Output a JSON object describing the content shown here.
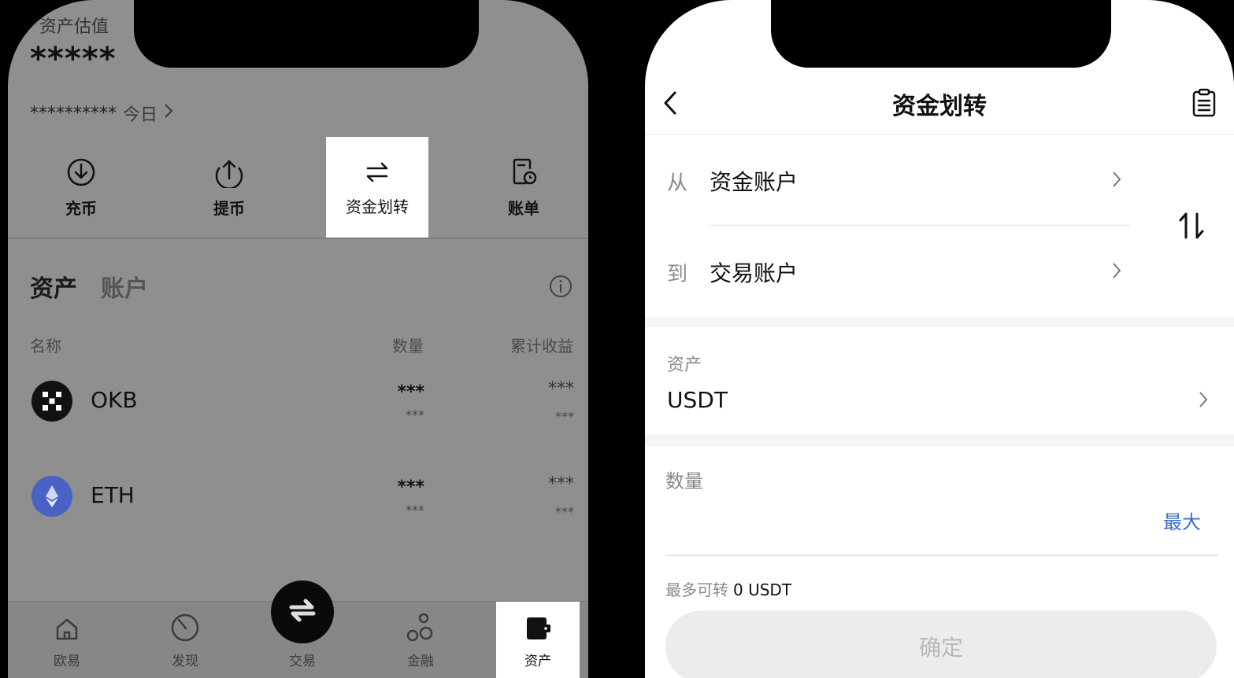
{
  "left": {
    "partial_title": "资产估值",
    "balance_masked": "*****",
    "sub_masked": "**********",
    "sub_today": "今日",
    "actions": [
      {
        "label": "充币",
        "icon": "deposit-icon"
      },
      {
        "label": "提币",
        "icon": "withdraw-icon"
      },
      {
        "label": "资金划转",
        "icon": "transfer-icon"
      },
      {
        "label": "账单",
        "icon": "bill-icon"
      }
    ],
    "tabs": [
      "资产",
      "账户"
    ],
    "columns": {
      "name": "名称",
      "qty": "数量",
      "pnl": "累计收益"
    },
    "coins": [
      {
        "name": "OKB",
        "qty": "***",
        "qty_sub": "***",
        "pnl": "***",
        "pnl_sub": "***"
      },
      {
        "name": "ETH",
        "qty": "***",
        "qty_sub": "***",
        "pnl": "***",
        "pnl_sub": "***"
      }
    ],
    "nav": [
      {
        "label": "欧易",
        "icon": "home-icon"
      },
      {
        "label": "发现",
        "icon": "discover-icon"
      },
      {
        "label": "交易",
        "icon": "trade-icon"
      },
      {
        "label": "金融",
        "icon": "finance-icon"
      },
      {
        "label": "资产",
        "icon": "wallet-icon"
      }
    ]
  },
  "right": {
    "title": "资金划转",
    "from_prefix": "从",
    "from_value": "资金账户",
    "to_prefix": "到",
    "to_value": "交易账户",
    "asset_label": "资产",
    "asset_value": "USDT",
    "qty_label": "数量",
    "qty_placeholder": "",
    "max_label": "最大",
    "avail_label": "最多可转",
    "avail_value": "0 USDT",
    "confirm_label": "确定"
  },
  "colors": {
    "left_bg": "#8f8f8f",
    "highlight": "#ffffff",
    "accent_blue": "#3b6fc9",
    "eth_blue": "#4a62c4",
    "button_disabled": "#ececec"
  }
}
